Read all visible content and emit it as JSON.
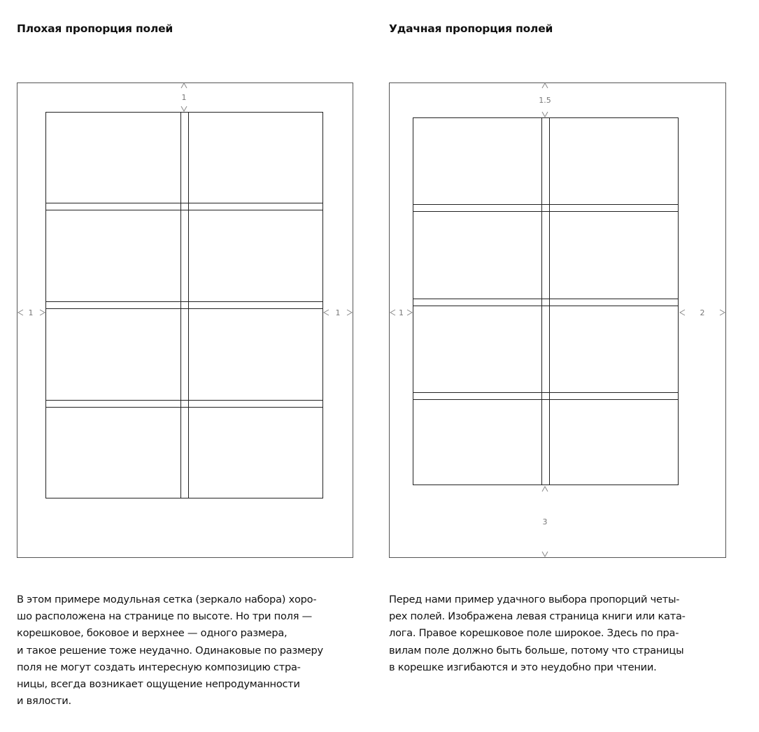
{
  "left": {
    "title": "Плохая пропорция полей",
    "margins": {
      "top": "1",
      "left": "1",
      "right": "1"
    },
    "caption_lines": [
      "В этом примере модульная сетка (зеркало набора) хоро-",
      "шо расположена на странице по высоте. Но три поля —",
      "корешковое, боковое и верхнее — одного размера,",
      "и такое решение тоже неудачно. Одинаковые по размеру",
      "поля не могут создать интересную композицию стра-",
      "ницы, всегда возникает ощущение непродуманности",
      "и вялости."
    ]
  },
  "right": {
    "title": "Удачная пропорция полей",
    "margins": {
      "top": "1.5",
      "left": "1",
      "right": "2",
      "bottom": "3"
    },
    "caption_lines": [
      "Перед нами пример удачного выбора пропорций четы-",
      "рех полей. Изображена левая страница книги или ката-",
      "лога. Правое корешковое поле широкое. Здесь по пра-",
      "вилам поле должно быть больше, потому что страницы",
      "в корешке изгибаются и это неудобно при чтении."
    ]
  },
  "colors": {
    "grid_line": "#222222",
    "page_border": "#555555",
    "marker": "#888888"
  }
}
